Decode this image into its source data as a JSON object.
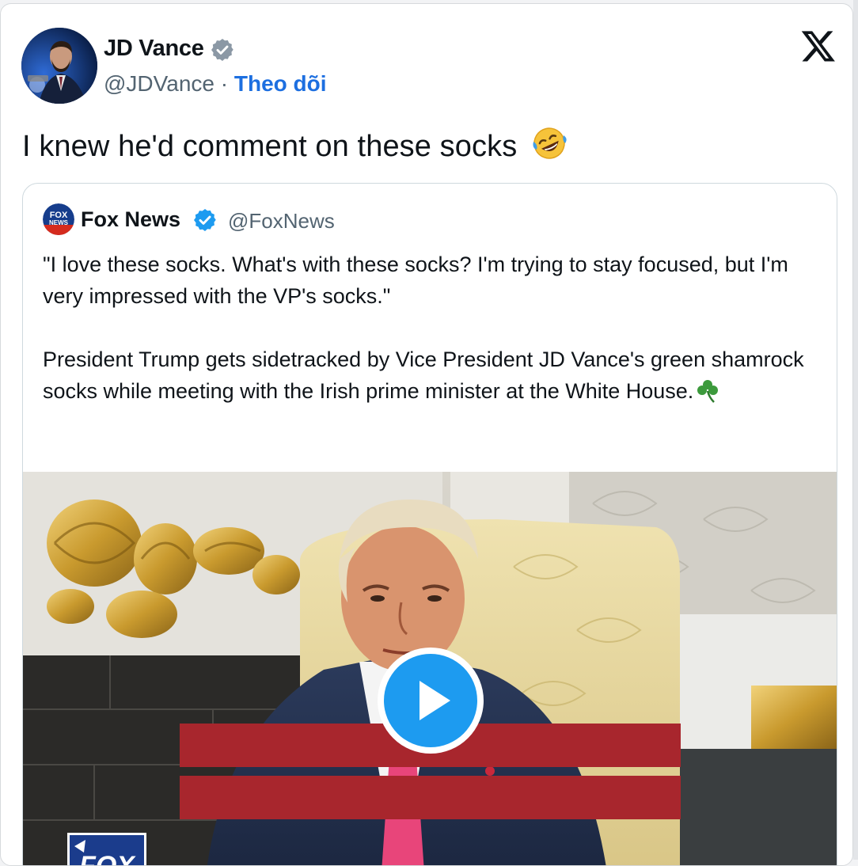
{
  "tweet": {
    "author_name": "JD Vance",
    "author_handle": "@JDVance",
    "separator": " · ",
    "follow_label": "Theo dõi",
    "text": "I knew he'd comment on these socks",
    "emoji": "rolling-on-the-floor-laughing"
  },
  "quoted_tweet": {
    "author_name": "Fox News",
    "author_handle": "@FoxNews",
    "logo_text": "FOX NEWS",
    "paragraph_1": "\"I love these socks. What's with these socks? I'm trying to stay focused, but I'm very impressed with the VP's socks.\"",
    "paragraph_2": "President Trump gets sidetracked by Vice President JD Vance's green shamrock socks while meeting with the Irish prime minister at the White House.",
    "media": {
      "type": "video",
      "play_icon": "play-icon",
      "watermark_text": "FOX"
    }
  },
  "icons": {
    "close": "x-logo-icon",
    "verified": "verified-badge-icon",
    "shamrock": "shamrock-icon"
  },
  "colors": {
    "follow_link": "#1d6fe0",
    "verified_badge": "#1d9bf0",
    "play_button": "#1d9bf0",
    "redaction_bar": "#a8262d",
    "secondary_text": "#536471"
  }
}
